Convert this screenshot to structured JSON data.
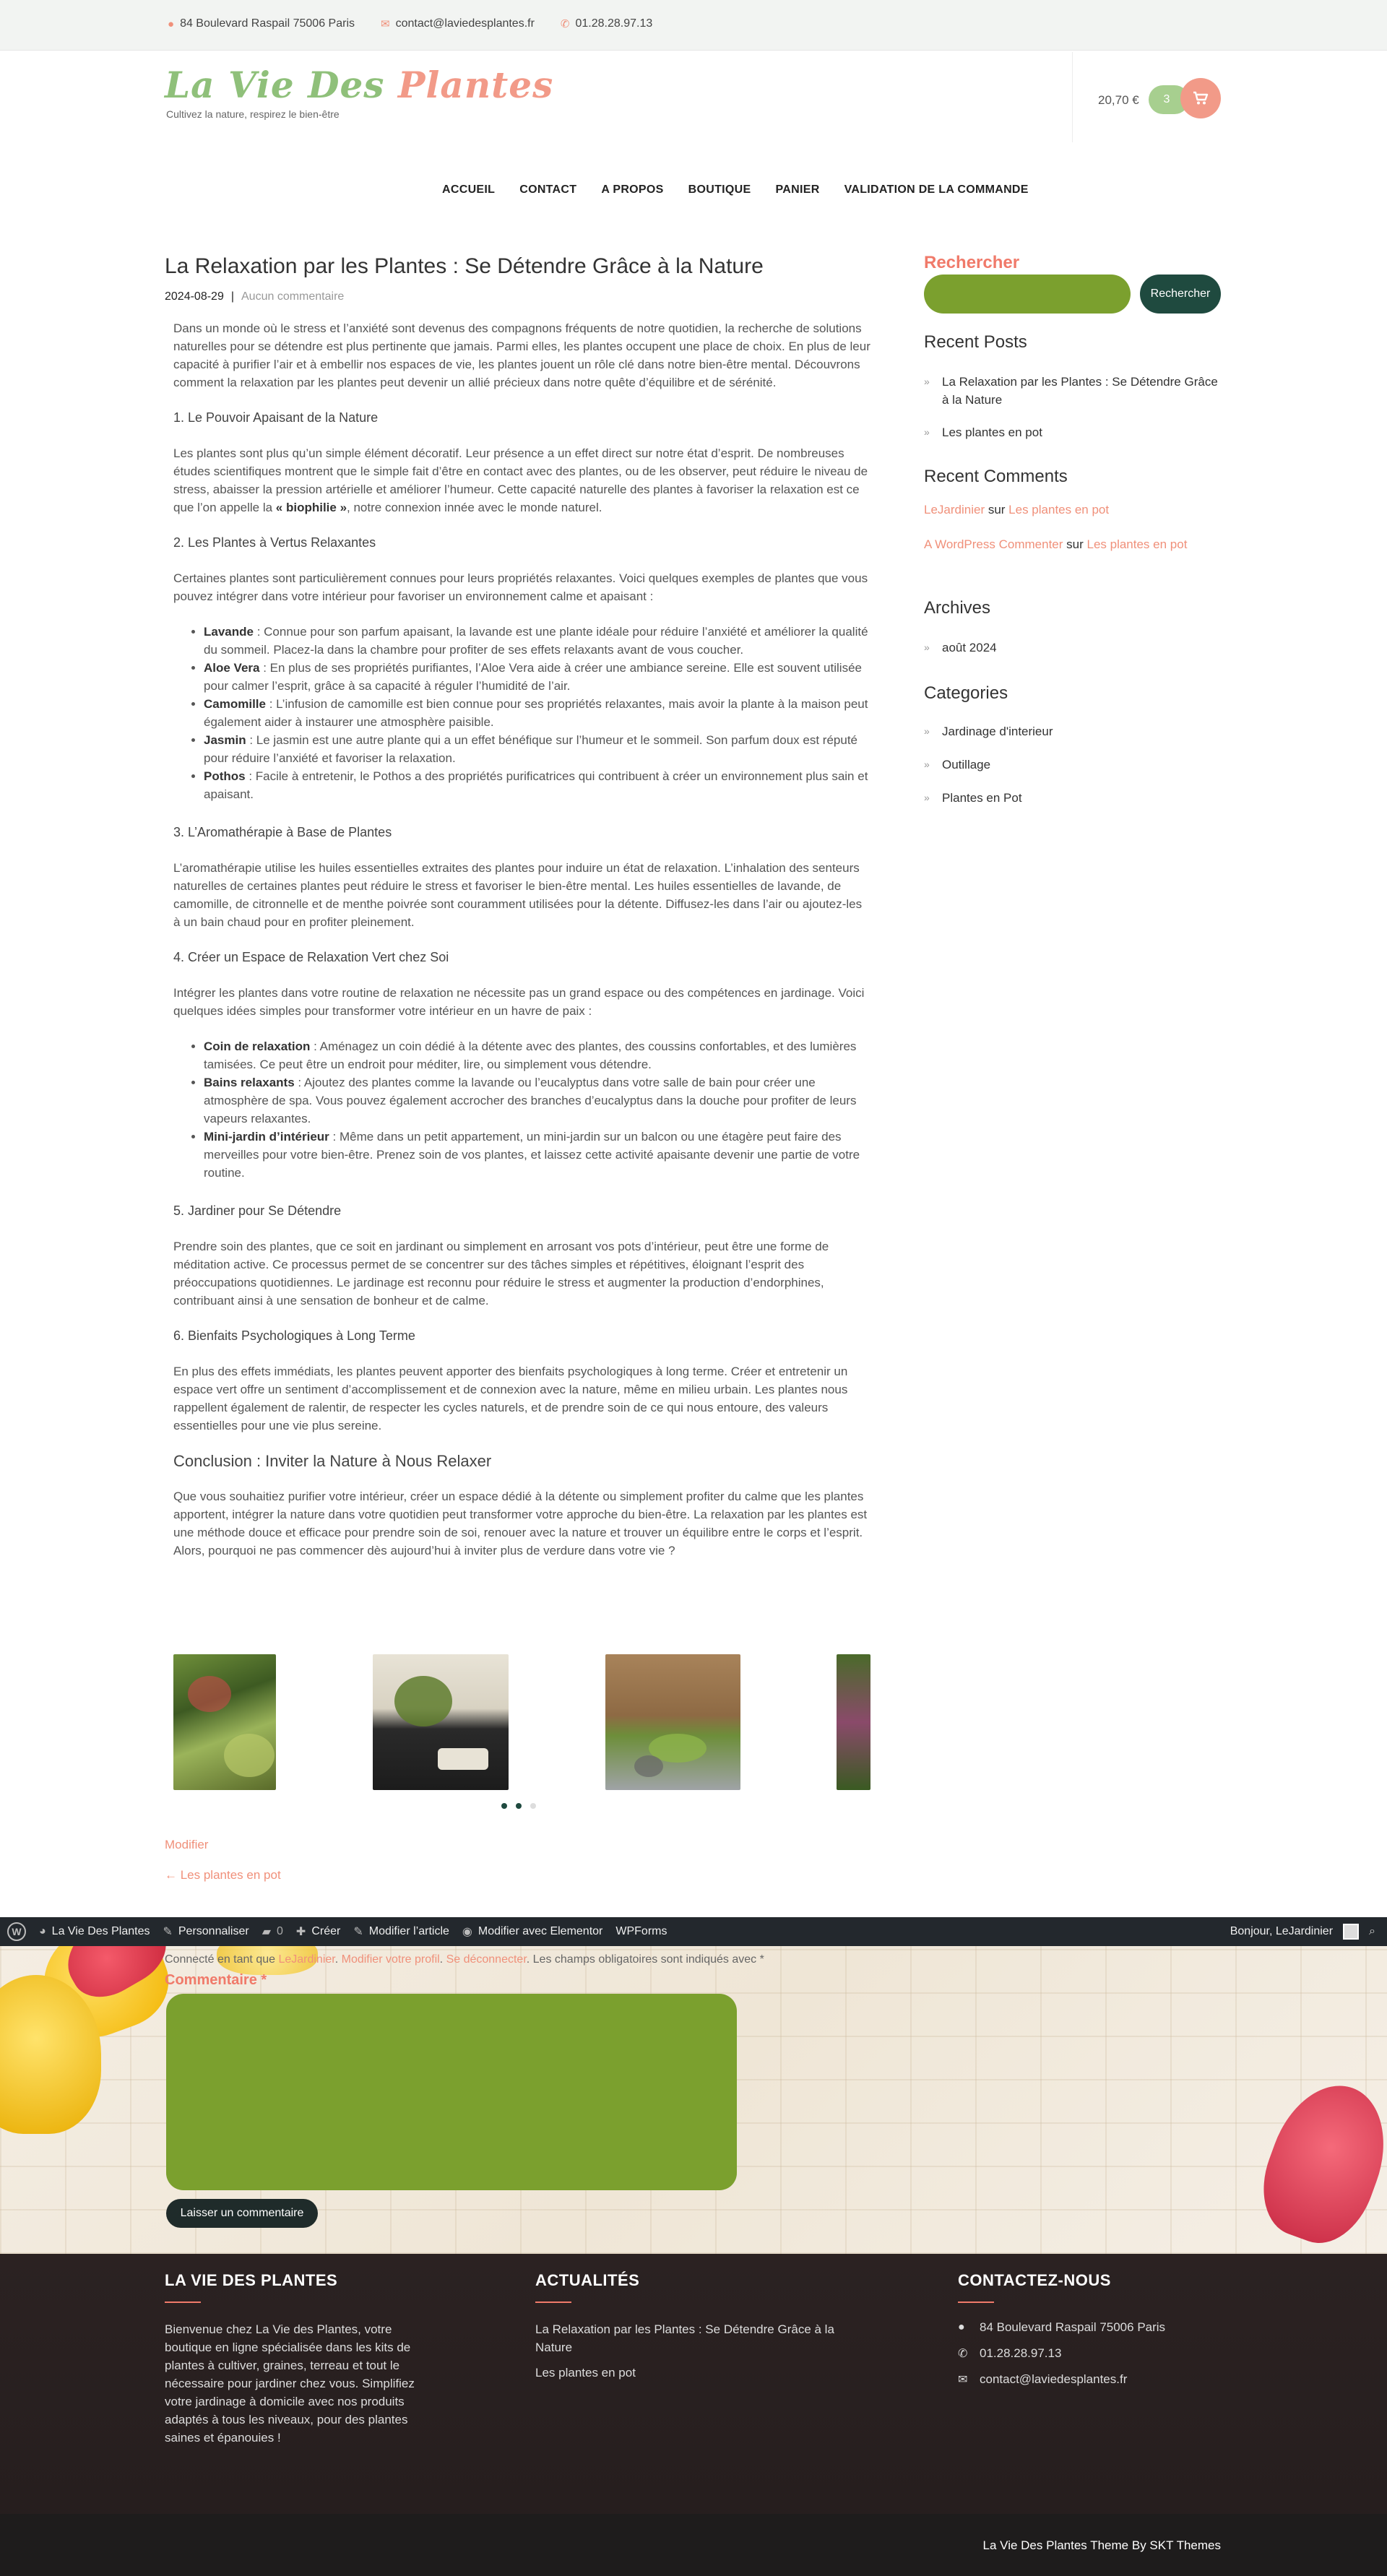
{
  "topbar": {
    "address": "84 Boulevard Raspail 75006 Paris",
    "email": "contact@laviedesplantes.fr",
    "phone": "01.28.28.97.13"
  },
  "header": {
    "logo_part1": "La Vie Des ",
    "logo_part2": "Plantes",
    "tagline": "Cultivez la nature, respirez le bien-être",
    "cart_amount": "20,70 €",
    "cart_count": "3"
  },
  "nav": [
    "ACCUEIL",
    "CONTACT",
    "A PROPOS",
    "BOUTIQUE",
    "PANIER",
    "VALIDATION DE LA COMMANDE"
  ],
  "post": {
    "title": "La Relaxation par les Plantes : Se Détendre Grâce à la Nature",
    "date": "2024-08-29",
    "separator": "|",
    "comments": "Aucun commentaire",
    "intro": "Dans un monde où le stress et l’anxiété sont devenus des compagnons fréquents de notre quotidien, la recherche de solutions naturelles pour se détendre est plus pertinente que jamais. Parmi elles, les plantes occupent une place de choix. En plus de leur capacité à purifier l’air et à embellir nos espaces de vie, les plantes jouent un rôle clé dans notre bien-être mental. Découvrons comment la relaxation par les plantes peut devenir un allié précieux dans notre quête d’équilibre et de sérénité.",
    "h1": "1. Le Pouvoir Apaisant de la Nature",
    "p1a": "Les plantes sont plus qu’un simple élément décoratif. Leur présence a un effet direct sur notre état d’esprit. De nombreuses études scientifiques montrent que le simple fait d’être en contact avec des plantes, ou de les observer, peut réduire le niveau de stress, abaisser la pression artérielle et améliorer l’humeur. Cette capacité naturelle des plantes à favoriser la relaxation est ce que l’on appelle la ",
    "p1b": "« biophilie »",
    "p1c": ", notre connexion innée avec le monde naturel.",
    "h2": "2. Les Plantes à Vertus Relaxantes",
    "p2": "Certaines plantes sont particulièrement connues pour leurs propriétés relaxantes. Voici quelques exemples de plantes que vous pouvez intégrer dans votre intérieur pour favoriser un environnement calme et apaisant :",
    "list1": [
      {
        "b": "Lavande",
        "t": " : Connue pour son parfum apaisant, la lavande est une plante idéale pour réduire l’anxiété et améliorer la qualité du sommeil. Placez-la dans la chambre pour profiter de ses effets relaxants avant de vous coucher."
      },
      {
        "b": "Aloe Vera",
        "t": " : En plus de ses propriétés purifiantes, l’Aloe Vera aide à créer une ambiance sereine. Elle est souvent utilisée pour calmer l’esprit, grâce à sa capacité à réguler l’humidité de l’air."
      },
      {
        "b": "Camomille",
        "t": " : L’infusion de camomille est bien connue pour ses propriétés relaxantes, mais avoir la plante à la maison peut également aider à instaurer une atmosphère paisible."
      },
      {
        "b": "Jasmin",
        "t": " : Le jasmin est une autre plante qui a un effet bénéfique sur l’humeur et le sommeil. Son parfum doux est réputé pour réduire l’anxiété et favoriser la relaxation."
      },
      {
        "b": "Pothos",
        "t": " : Facile à entretenir, le Pothos a des propriétés purificatrices qui contribuent à créer un environnement plus sain et apaisant."
      }
    ],
    "h3": "3. L’Aromathérapie à Base de Plantes",
    "p3": "L’aromathérapie utilise les huiles essentielles extraites des plantes pour induire un état de relaxation. L’inhalation des senteurs naturelles de certaines plantes peut réduire le stress et favoriser le bien-être mental. Les huiles essentielles de lavande, de camomille, de citronnelle et de menthe poivrée sont couramment utilisées pour la détente. Diffusez-les dans l’air ou ajoutez-les à un bain chaud pour en profiter pleinement.",
    "h4": "4. Créer un Espace de Relaxation Vert chez Soi",
    "p4": "Intégrer les plantes dans votre routine de relaxation ne nécessite pas un grand espace ou des compétences en jardinage. Voici quelques idées simples pour transformer votre intérieur en un havre de paix :",
    "list2": [
      {
        "b": "Coin de relaxation",
        "t": " : Aménagez un coin dédié à la détente avec des plantes, des coussins confortables, et des lumières tamisées. Ce peut être un endroit pour méditer, lire, ou simplement vous détendre."
      },
      {
        "b": "Bains relaxants",
        "t": " : Ajoutez des plantes comme la lavande ou l’eucalyptus dans votre salle de bain pour créer une atmosphère de spa. Vous pouvez également accrocher des branches d’eucalyptus dans la douche pour profiter de leurs vapeurs relaxantes."
      },
      {
        "b": "Mini-jardin d’intérieur",
        "t": " : Même dans un petit appartement, un mini-jardin sur un balcon ou une étagère peut faire des merveilles pour votre bien-être. Prenez soin de vos plantes, et laissez cette activité apaisante devenir une partie de votre routine."
      }
    ],
    "h5": "5. Jardiner pour Se Détendre",
    "p5": "Prendre soin des plantes, que ce soit en jardinant ou simplement en arrosant vos pots d’intérieur, peut être une forme de méditation active. Ce processus permet de se concentrer sur des tâches simples et répétitives, éloignant l’esprit des préoccupations quotidiennes. Le jardinage est reconnu pour réduire le stress et augmenter la production d’endorphines, contribuant ainsi à une sensation de bonheur et de calme.",
    "h6": "6. Bienfaits Psychologiques à Long Terme",
    "p6": "En plus des effets immédiats, les plantes peuvent apporter des bienfaits psychologiques à long terme. Créer et entretenir un espace vert offre un sentiment d’accomplissement et de connexion avec la nature, même en milieu urbain. Les plantes nous rappellent également de ralentir, de respecter les cycles naturels, et de prendre soin de ce qui nous entoure, des valeurs essentielles pour une vie plus sereine.",
    "hc": "Conclusion : Inviter la Nature à Nous Relaxer",
    "pc": "Que vous souhaitiez purifier votre intérieur, créer un espace dédié à la détente ou simplement profiter du calme que les plantes apportent, intégrer la nature dans votre quotidien peut transformer votre approche du bien-être. La relaxation par les plantes est une méthode douce et efficace pour prendre soin de soi, renouer avec la nature et trouver un équilibre entre le corps et l’esprit. Alors, pourquoi ne pas commencer dès aujourd’hui à inviter plus de verdure dans votre vie ?",
    "edit": "Modifier",
    "prev": "← Les plantes en pot"
  },
  "sidebar": {
    "search_title": "Rechercher",
    "search_button": "Rechercher",
    "recent_posts_title": "Recent Posts",
    "recent_posts": [
      "La Relaxation par les Plantes : Se Détendre Grâce à la Nature",
      "Les plantes en pot"
    ],
    "recent_comments_title": "Recent Comments",
    "recent_comments": [
      {
        "author": "LeJardinier",
        "on": " sur ",
        "post": "Les plantes en pot"
      },
      {
        "author": "A WordPress Commenter",
        "on": " sur ",
        "post": "Les plantes en pot"
      }
    ],
    "archives_title": "Archives",
    "archives": [
      "août 2024"
    ],
    "categories_title": "Categories",
    "categories": [
      "Jardinage d'interieur",
      "Outillage",
      "Plantes en Pot"
    ]
  },
  "adminbar": {
    "wp": "W",
    "site": "La Vie Des Plantes",
    "customize": "Personnaliser",
    "comments_count": "0",
    "new": "Créer",
    "edit_post": "Modifier l’article",
    "elementor": "Modifier avec Elementor",
    "wpforms": "WPForms",
    "greeting": "Bonjour, LeJardinier"
  },
  "comment_form": {
    "logged_prefix": "Connecté en tant que ",
    "logged_user": "LeJardinier",
    "edit_profile": "Modifier votre profil",
    "logout": "Se déconnecter",
    "required": "Les champs obligatoires sont indiqués avec *",
    "label": "Commentaire",
    "required_mark": "*",
    "submit": "Laisser un commentaire"
  },
  "footer": {
    "col1_title": "LA VIE DES PLANTES",
    "col1_text": "Bienvenue chez La Vie des Plantes, votre boutique en ligne spécialisée dans les kits de plantes à cultiver, graines, terreau et tout le nécessaire pour jardiner chez vous. Simplifiez votre jardinage à domicile avec nos produits adaptés à tous les niveaux, pour des plantes saines et épanouies !",
    "col2_title": "ACTUALITÉS",
    "col2_links": [
      "La Relaxation par les Plantes : Se Détendre Grâce à la Nature",
      "Les plantes en pot"
    ],
    "col3_title": "CONTACTEZ-NOUS",
    "address": "84 Boulevard Raspail 75006 Paris",
    "phone": "01.28.28.97.13",
    "email": "contact@laviedesplantes.fr",
    "credit": "La Vie Des Plantes Theme By SKT Themes"
  },
  "colors": {
    "accent_coral": "#f07a6a",
    "accent_green": "#7ba02e",
    "dark_green": "#1f4a3f",
    "admin_bar": "#23282d",
    "footer_bg": "#261e1e"
  }
}
